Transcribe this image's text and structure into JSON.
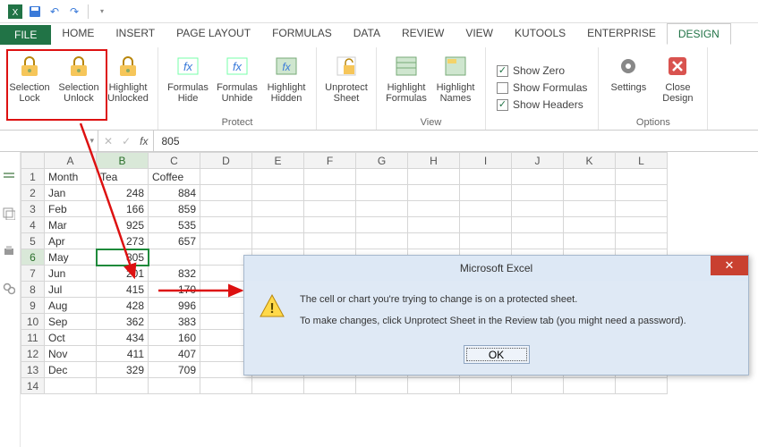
{
  "qat": {
    "items": [
      "save",
      "undo",
      "redo",
      "dropdown"
    ]
  },
  "tabs": {
    "file": "FILE",
    "list": [
      "HOME",
      "INSERT",
      "PAGE LAYOUT",
      "FORMULAS",
      "DATA",
      "REVIEW",
      "VIEW",
      "KUTOOLS",
      "ENTERPRISE",
      "DESIGN"
    ],
    "active": "DESIGN"
  },
  "ribbon": {
    "groups": [
      {
        "label": "",
        "buttons": [
          {
            "name": "selection-lock",
            "label": "Selection\nLock"
          },
          {
            "name": "selection-unlock",
            "label": "Selection\nUnlock"
          },
          {
            "name": "highlight-unlocked",
            "label": "Highlight\nUnlocked"
          }
        ]
      },
      {
        "label": "Protect",
        "buttons": [
          {
            "name": "formulas-hide",
            "label": "Formulas\nHide"
          },
          {
            "name": "formulas-unhide",
            "label": "Formulas\nUnhide"
          },
          {
            "name": "highlight-hidden",
            "label": "Highlight\nHidden"
          }
        ]
      },
      {
        "label": "",
        "buttons": [
          {
            "name": "unprotect-sheet",
            "label": "Unprotect\nSheet"
          }
        ]
      },
      {
        "label": "View",
        "buttons": [
          {
            "name": "highlight-formulas",
            "label": "Highlight\nFormulas"
          },
          {
            "name": "highlight-names",
            "label": "Highlight\nNames"
          }
        ]
      },
      {
        "label": "",
        "type": "checks",
        "checks": [
          {
            "name": "show-zero",
            "label": "Show Zero",
            "checked": true
          },
          {
            "name": "show-formulas",
            "label": "Show Formulas",
            "checked": false
          },
          {
            "name": "show-headers",
            "label": "Show Headers",
            "checked": true
          }
        ]
      },
      {
        "label": "Options",
        "buttons": [
          {
            "name": "settings",
            "label": "Settings"
          },
          {
            "name": "close-design",
            "label": "Close\nDesign"
          }
        ]
      }
    ]
  },
  "formula_bar": {
    "name_box": "",
    "fx": "fx",
    "value": "805"
  },
  "sheet": {
    "columns": [
      "A",
      "B",
      "C",
      "D",
      "E",
      "F",
      "G",
      "H",
      "I",
      "J",
      "K",
      "L"
    ],
    "sel_col": "B",
    "sel_row": 6,
    "rows": [
      {
        "r": 1,
        "A": "Month",
        "B": "Tea",
        "C": "Coffee"
      },
      {
        "r": 2,
        "A": "Jan",
        "B": "248",
        "C": "884"
      },
      {
        "r": 3,
        "A": "Feb",
        "B": "166",
        "C": "859"
      },
      {
        "r": 4,
        "A": "Mar",
        "B": "925",
        "C": "535"
      },
      {
        "r": 5,
        "A": "Apr",
        "B": "273",
        "C": "657"
      },
      {
        "r": 6,
        "A": "May",
        "B": "805",
        "C": ""
      },
      {
        "r": 7,
        "A": "Jun",
        "B": "201",
        "C": "832"
      },
      {
        "r": 8,
        "A": "Jul",
        "B": "415",
        "C": "170"
      },
      {
        "r": 9,
        "A": "Aug",
        "B": "428",
        "C": "996"
      },
      {
        "r": 10,
        "A": "Sep",
        "B": "362",
        "C": "383"
      },
      {
        "r": 11,
        "A": "Oct",
        "B": "434",
        "C": "160"
      },
      {
        "r": 12,
        "A": "Nov",
        "B": "411",
        "C": "407"
      },
      {
        "r": 13,
        "A": "Dec",
        "B": "329",
        "C": "709"
      },
      {
        "r": 14,
        "A": "",
        "B": "",
        "C": ""
      }
    ]
  },
  "dialog": {
    "title": "Microsoft Excel",
    "line1": "The cell or chart you're trying to change is on a protected sheet.",
    "line2": "To make changes, click Unprotect Sheet in the Review tab (you might need a password).",
    "ok": "OK"
  },
  "chart_data": {
    "type": "table",
    "title": "",
    "columns": [
      "Month",
      "Tea",
      "Coffee"
    ],
    "rows": [
      [
        "Jan",
        248,
        884
      ],
      [
        "Feb",
        166,
        859
      ],
      [
        "Mar",
        925,
        535
      ],
      [
        "Apr",
        273,
        657
      ],
      [
        "May",
        805,
        null
      ],
      [
        "Jun",
        201,
        832
      ],
      [
        "Jul",
        415,
        170
      ],
      [
        "Aug",
        428,
        996
      ],
      [
        "Sep",
        362,
        383
      ],
      [
        "Oct",
        434,
        160
      ],
      [
        "Nov",
        411,
        407
      ],
      [
        "Dec",
        329,
        709
      ]
    ]
  }
}
